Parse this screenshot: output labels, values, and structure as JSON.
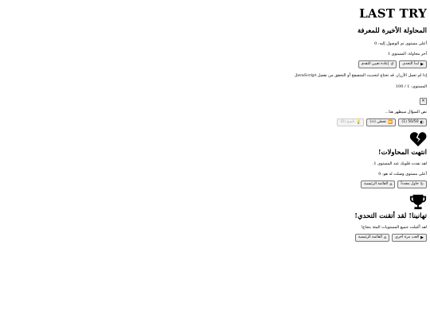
{
  "header": {
    "title": "LAST TRY",
    "subtitle": "المحاولة الأخيرة للمعرفة"
  },
  "start": {
    "high_level_text": "أعلى مستوى تم الوصول إليه: 0",
    "last_attempt_text": "آخر محاولة: المستوى 1",
    "start_challenge_label": "ابدأ التحدي",
    "reset_progress_label": "إعادة تعيين التقدم",
    "js_warning": "إذا لم تعمل الأزرار، قد تحتاج لتحديث المتصفح أو التحقق من تفعيل JavaScript.",
    "close_icon": "✕"
  },
  "game": {
    "level_text": "المستوى: 1 / 100",
    "question_placeholder": "نص السؤال سيظهر هنا...",
    "lifeline_5050_label": "50/50 (1)",
    "lifeline_skip_label": "تخطي (∞)",
    "lifeline_hint_label": "تلميح (0)"
  },
  "game_over": {
    "icon": "broken-heart-icon",
    "title": "انتهت المحاولات!",
    "lives_text": "لقد نفدت قلوبك عند المستوى 1.",
    "best_text": "أعلى مستوى وصلت له هو: 0",
    "retry_label": "حاول مجدداً",
    "home_label": "القائمة الرئيسية"
  },
  "win": {
    "icon": "trophy-icon",
    "title": "تهانينا! لقد أتقنت التحدي!",
    "message": "لقد أكملت جميع المستويات المئة بنجاح!",
    "play_again_label": "العب مرة أخرى",
    "home_label": "القائمة الرئيسية"
  }
}
